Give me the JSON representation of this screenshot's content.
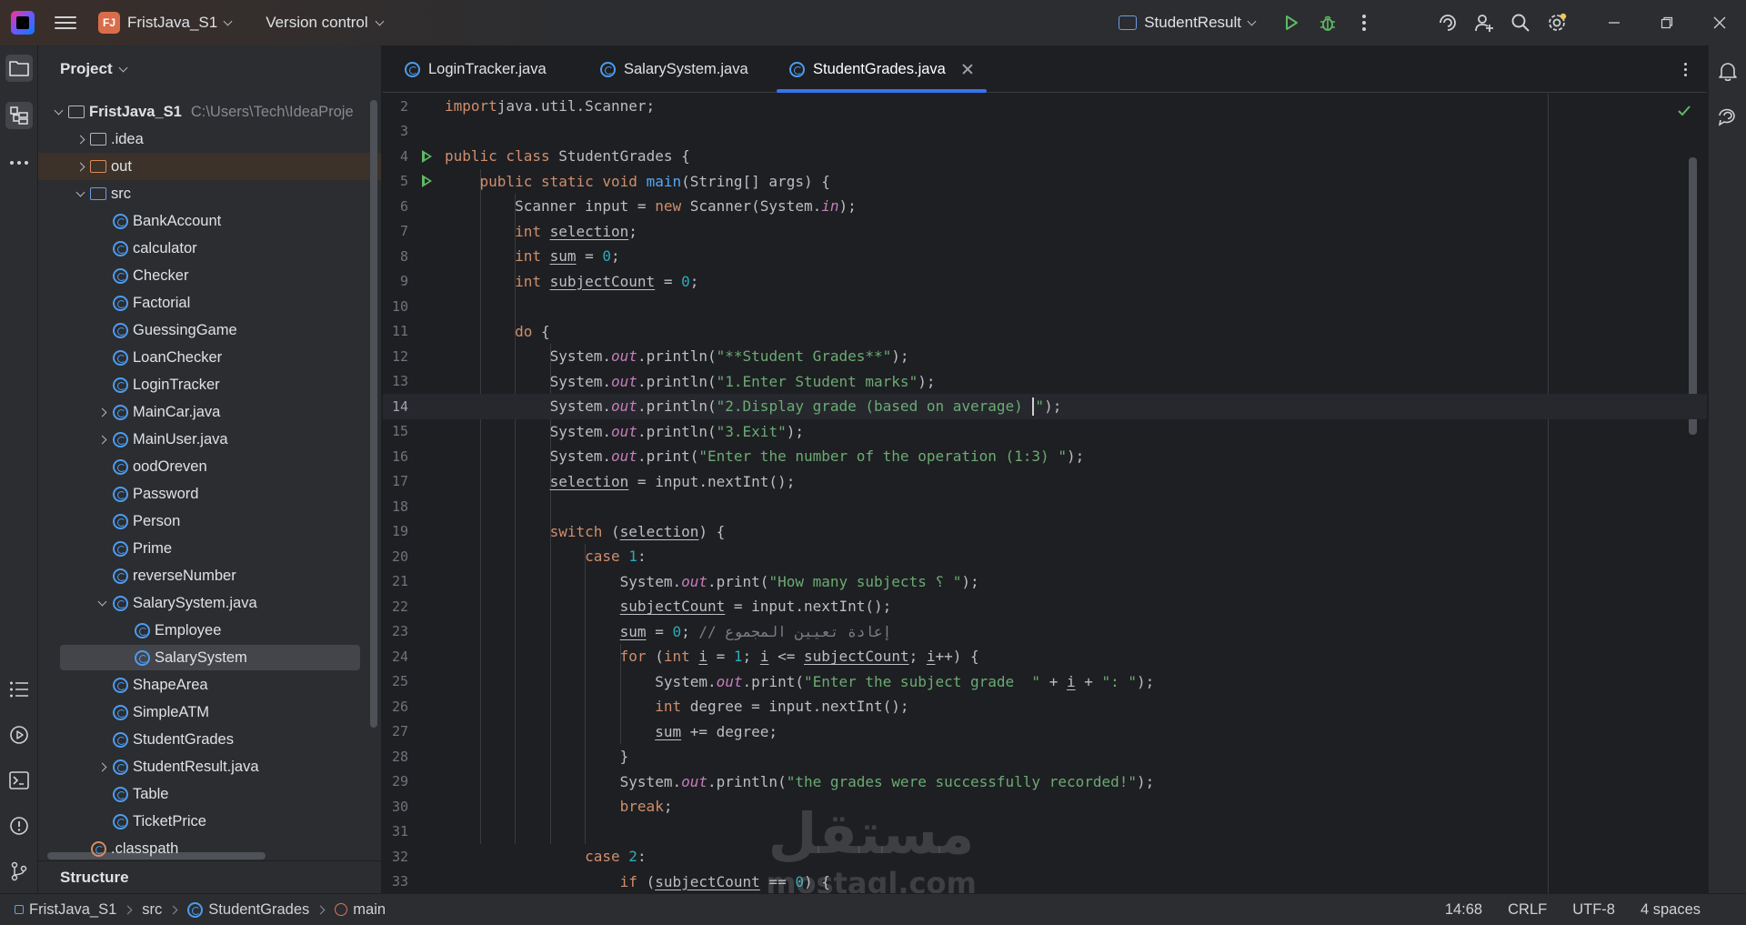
{
  "title_bar": {
    "project_badge": "FJ",
    "project_name": "FristJava_S1",
    "vcs_label": "Version control",
    "run_config": "StudentResult"
  },
  "project_panel": {
    "header": "Project",
    "root_name": "FristJava_S1",
    "root_path": "C:\\Users\\Tech\\IdeaProje",
    "items": [
      {
        "label": ".idea",
        "level": 1,
        "type": "folder",
        "arrow": "right"
      },
      {
        "label": "out",
        "level": 1,
        "type": "folder-orange",
        "arrow": "right"
      },
      {
        "label": "src",
        "level": 1,
        "type": "folder-blue",
        "arrow": "down"
      },
      {
        "label": "BankAccount",
        "level": 2,
        "type": "class"
      },
      {
        "label": "calculator",
        "level": 2,
        "type": "class"
      },
      {
        "label": "Checker",
        "level": 2,
        "type": "class"
      },
      {
        "label": "Factorial",
        "level": 2,
        "type": "class"
      },
      {
        "label": "GuessingGame",
        "level": 2,
        "type": "class"
      },
      {
        "label": "LoanChecker",
        "level": 2,
        "type": "class"
      },
      {
        "label": "LoginTracker",
        "level": 2,
        "type": "class"
      },
      {
        "label": "MainCar.java",
        "level": 2,
        "type": "class",
        "arrow": "right"
      },
      {
        "label": "MainUser.java",
        "level": 2,
        "type": "class",
        "arrow": "right"
      },
      {
        "label": "oodOreven",
        "level": 2,
        "type": "class"
      },
      {
        "label": "Password",
        "level": 2,
        "type": "class"
      },
      {
        "label": "Person",
        "level": 2,
        "type": "class"
      },
      {
        "label": "Prime",
        "level": 2,
        "type": "class"
      },
      {
        "label": "reverseNumber",
        "level": 2,
        "type": "class"
      },
      {
        "label": "SalarySystem.java",
        "level": 2,
        "type": "class",
        "arrow": "down"
      },
      {
        "label": "Employee",
        "level": 3,
        "type": "class-plain"
      },
      {
        "label": "SalarySystem",
        "level": 3,
        "type": "class"
      },
      {
        "label": "ShapeArea",
        "level": 2,
        "type": "class"
      },
      {
        "label": "SimpleATM",
        "level": 2,
        "type": "class"
      },
      {
        "label": "StudentGrades",
        "level": 2,
        "type": "class"
      },
      {
        "label": "StudentResult.java",
        "level": 2,
        "type": "class",
        "arrow": "right"
      },
      {
        "label": "Table",
        "level": 2,
        "type": "class"
      },
      {
        "label": "TicketPrice",
        "level": 2,
        "type": "class"
      },
      {
        "label": ".classpath",
        "level": 1,
        "type": "file"
      }
    ],
    "structure_label": "Structure"
  },
  "tabs": [
    {
      "label": "LoginTracker.java"
    },
    {
      "label": "SalarySystem.java"
    },
    {
      "label": "StudentGrades.java"
    }
  ],
  "code": [
    {
      "n": "2",
      "t": [
        [
          "kw",
          "import"
        ],
        [
          "",
          "java.util.Scanner;"
        ]
      ]
    },
    {
      "n": "3",
      "t": []
    },
    {
      "n": "4",
      "t": [
        [
          "kw",
          "public class "
        ],
        [
          "",
          "StudentGrades {"
        ]
      ],
      "run": true
    },
    {
      "n": "5",
      "t": [
        [
          "",
          "    "
        ],
        [
          "kw",
          "public static void "
        ],
        [
          "fn",
          "main"
        ],
        [
          "",
          "(String[] args) {"
        ]
      ],
      "run": true
    },
    {
      "n": "6",
      "t": [
        [
          "",
          "        Scanner input = "
        ],
        [
          "kw",
          "new "
        ],
        [
          "",
          "Scanner(System."
        ],
        [
          "st",
          "in"
        ],
        [
          "",
          ");"
        ]
      ]
    },
    {
      "n": "7",
      "t": [
        [
          "",
          "        "
        ],
        [
          "kw",
          "int "
        ],
        [
          "var",
          "selection"
        ],
        [
          "",
          ";"
        ]
      ]
    },
    {
      "n": "8",
      "t": [
        [
          "",
          "        "
        ],
        [
          "kw",
          "int "
        ],
        [
          "var",
          "sum"
        ],
        [
          "",
          " = "
        ],
        [
          "num",
          "0"
        ],
        [
          "",
          ";"
        ]
      ]
    },
    {
      "n": "9",
      "t": [
        [
          "",
          "        "
        ],
        [
          "kw",
          "int "
        ],
        [
          "var",
          "subjectCount"
        ],
        [
          "",
          " = "
        ],
        [
          "num",
          "0"
        ],
        [
          "",
          ";"
        ]
      ]
    },
    {
      "n": "10",
      "t": []
    },
    {
      "n": "11",
      "t": [
        [
          "",
          "        "
        ],
        [
          "kw",
          "do "
        ],
        [
          "",
          "{"
        ]
      ]
    },
    {
      "n": "12",
      "t": [
        [
          "",
          "            System."
        ],
        [
          "st",
          "out"
        ],
        [
          "",
          ".println("
        ],
        [
          "str",
          "\"**Student Grades**\""
        ],
        [
          "",
          ");"
        ]
      ]
    },
    {
      "n": "13",
      "t": [
        [
          "",
          "            System."
        ],
        [
          "st",
          "out"
        ],
        [
          "",
          ".println("
        ],
        [
          "str",
          "\"1.Enter Student marks\""
        ],
        [
          "",
          ");"
        ]
      ]
    },
    {
      "n": "14",
      "t": [
        [
          "",
          "            System."
        ],
        [
          "st",
          "out"
        ],
        [
          "",
          ".println("
        ],
        [
          "str",
          "\"2.Display grade (based on average) "
        ],
        [
          "caret",
          ""
        ],
        [
          "str",
          "\""
        ],
        [
          "",
          ");"
        ]
      ],
      "current": true
    },
    {
      "n": "15",
      "t": [
        [
          "",
          "            System."
        ],
        [
          "st",
          "out"
        ],
        [
          "",
          ".println("
        ],
        [
          "str",
          "\"3.Exit\""
        ],
        [
          "",
          ");"
        ]
      ]
    },
    {
      "n": "16",
      "t": [
        [
          "",
          "            System."
        ],
        [
          "st",
          "out"
        ],
        [
          "",
          ".print("
        ],
        [
          "str",
          "\"Enter the number of the operation (1:3) \""
        ],
        [
          "",
          ");"
        ]
      ]
    },
    {
      "n": "17",
      "t": [
        [
          "",
          "            "
        ],
        [
          "var",
          "selection"
        ],
        [
          "",
          " = input.nextInt();"
        ]
      ]
    },
    {
      "n": "18",
      "t": []
    },
    {
      "n": "19",
      "t": [
        [
          "",
          "            "
        ],
        [
          "kw",
          "switch "
        ],
        [
          "",
          "("
        ],
        [
          "var",
          "selection"
        ],
        [
          "",
          ") {"
        ]
      ]
    },
    {
      "n": "20",
      "t": [
        [
          "",
          "                "
        ],
        [
          "kw",
          "case "
        ],
        [
          "num",
          "1"
        ],
        [
          "",
          ":"
        ]
      ]
    },
    {
      "n": "21",
      "t": [
        [
          "",
          "                    System."
        ],
        [
          "st",
          "out"
        ],
        [
          "",
          ".print("
        ],
        [
          "str",
          "\"How many subjects ؟ \""
        ],
        [
          "",
          ");"
        ]
      ]
    },
    {
      "n": "22",
      "t": [
        [
          "",
          "                    "
        ],
        [
          "var",
          "subjectCount"
        ],
        [
          "",
          " = input.nextInt();"
        ]
      ]
    },
    {
      "n": "23",
      "t": [
        [
          "",
          "                    "
        ],
        [
          "var",
          "sum"
        ],
        [
          "",
          " = "
        ],
        [
          "num",
          "0"
        ],
        [
          "",
          "; "
        ],
        [
          "cm",
          "// إعادة تعيين المجموع"
        ]
      ]
    },
    {
      "n": "24",
      "t": [
        [
          "",
          "                    "
        ],
        [
          "kw",
          "for "
        ],
        [
          "",
          "("
        ],
        [
          "kw",
          "int "
        ],
        [
          "var",
          "i"
        ],
        [
          "",
          " = "
        ],
        [
          "num",
          "1"
        ],
        [
          "",
          "; "
        ],
        [
          "var",
          "i"
        ],
        [
          "",
          " <= "
        ],
        [
          "var",
          "subjectCount"
        ],
        [
          "",
          "; "
        ],
        [
          "var",
          "i"
        ],
        [
          "",
          "++) {"
        ]
      ]
    },
    {
      "n": "25",
      "t": [
        [
          "",
          "                        System."
        ],
        [
          "st",
          "out"
        ],
        [
          "",
          ".print("
        ],
        [
          "str",
          "\"Enter the subject grade  \""
        ],
        [
          "",
          " + "
        ],
        [
          "var",
          "i"
        ],
        [
          "",
          " + "
        ],
        [
          "str",
          "\": \""
        ],
        [
          "",
          ");"
        ]
      ]
    },
    {
      "n": "26",
      "t": [
        [
          "",
          "                        "
        ],
        [
          "kw",
          "int "
        ],
        [
          "",
          "degree = input.nextInt();"
        ]
      ]
    },
    {
      "n": "27",
      "t": [
        [
          "",
          "                        "
        ],
        [
          "var",
          "sum"
        ],
        [
          "",
          " += degree;"
        ]
      ]
    },
    {
      "n": "28",
      "t": [
        [
          "",
          "                    }"
        ]
      ]
    },
    {
      "n": "29",
      "t": [
        [
          "",
          "                    System."
        ],
        [
          "st",
          "out"
        ],
        [
          "",
          ".println("
        ],
        [
          "str",
          "\"the grades were successfully recorded!\""
        ],
        [
          "",
          ");"
        ]
      ]
    },
    {
      "n": "30",
      "t": [
        [
          "",
          "                    "
        ],
        [
          "kw",
          "break"
        ],
        [
          "",
          ";"
        ]
      ]
    },
    {
      "n": "31",
      "t": []
    },
    {
      "n": "32",
      "t": [
        [
          "",
          "                "
        ],
        [
          "kw",
          "case "
        ],
        [
          "num",
          "2"
        ],
        [
          "",
          ":"
        ]
      ]
    },
    {
      "n": "33",
      "t": [
        [
          "",
          "                    "
        ],
        [
          "kw",
          "if "
        ],
        [
          "",
          "("
        ],
        [
          "var",
          "subjectCount"
        ],
        [
          "",
          " == "
        ],
        [
          "num",
          "0"
        ],
        [
          "",
          ") {"
        ]
      ]
    }
  ],
  "watermark": {
    "arabic": "مستقل",
    "latin": "mostaql.com"
  },
  "status_bar": {
    "breadcrumbs": [
      "FristJava_S1",
      "src",
      "StudentGrades",
      "main"
    ],
    "position": "14:68",
    "line_separator": "CRLF",
    "encoding": "UTF-8",
    "indent": "4 spaces"
  },
  "colors": {
    "accent": "#3574f0",
    "keyword": "#cf8e6d",
    "string": "#6aab73",
    "number": "#2aacb8",
    "function": "#56a8f5",
    "static_field": "#c77dbb",
    "run_icon": "#5fb865"
  }
}
